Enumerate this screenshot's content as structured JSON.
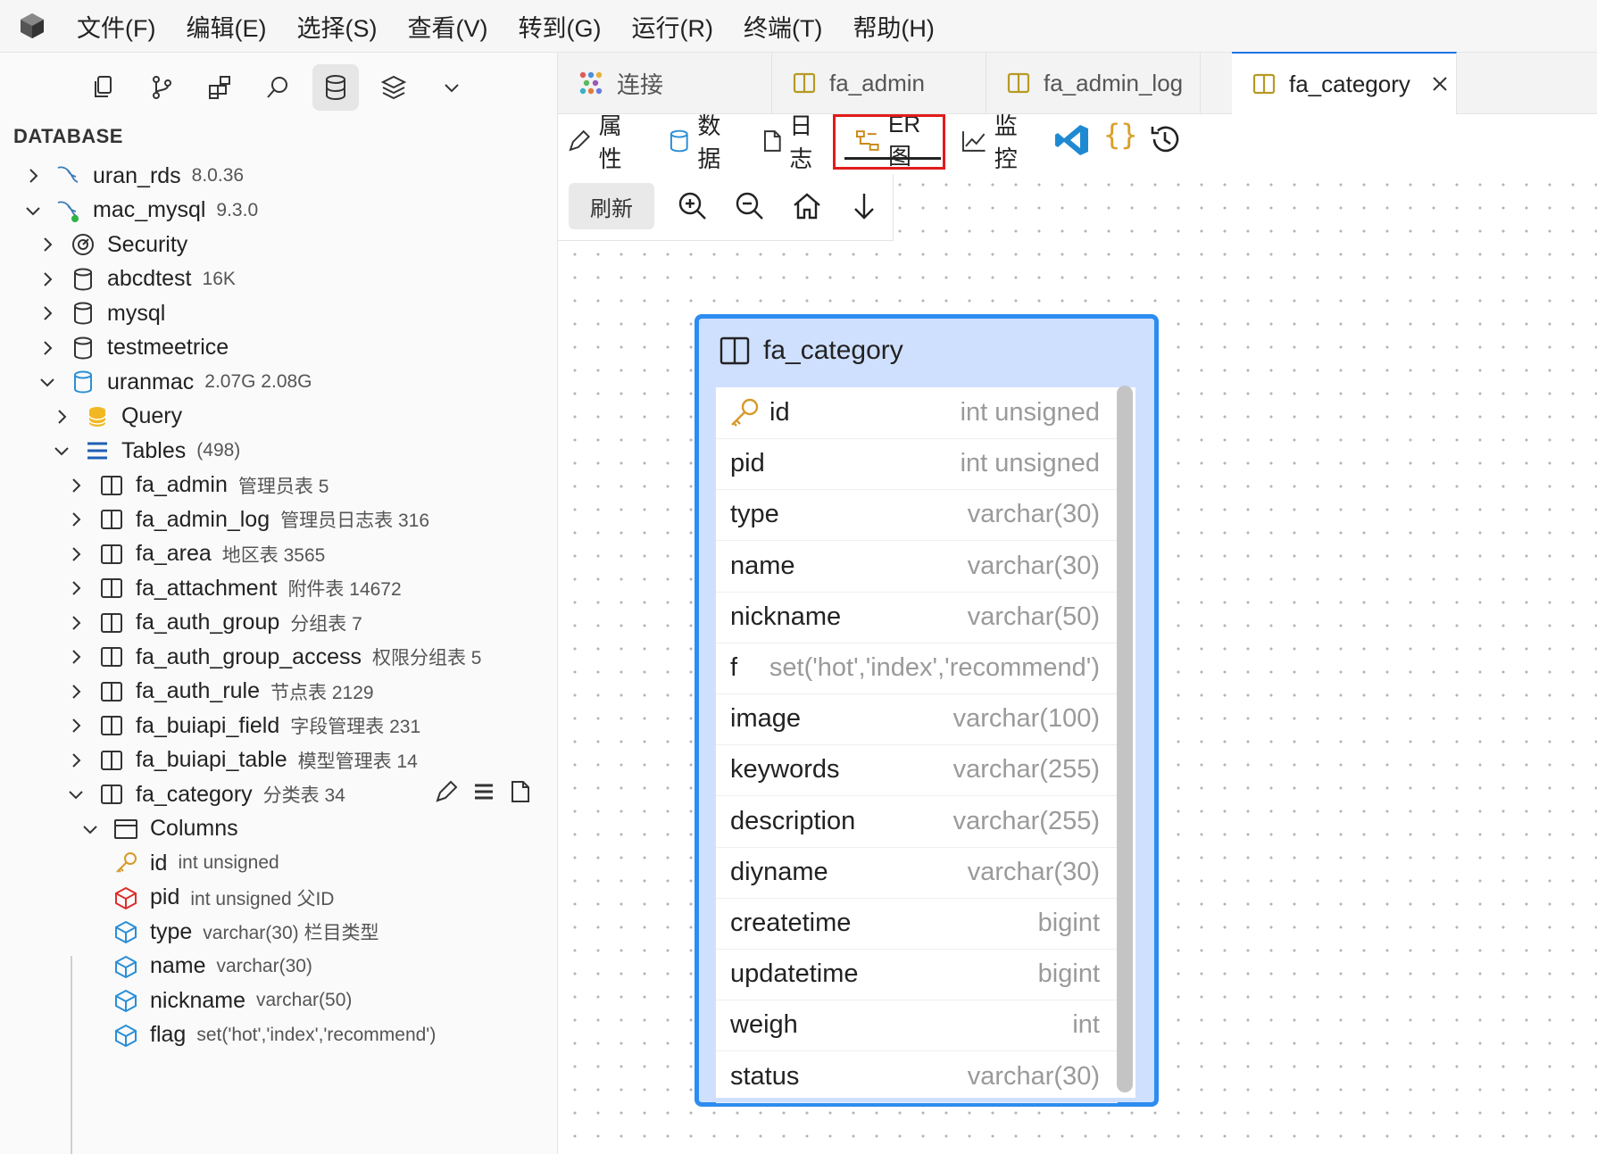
{
  "menu": [
    "文件(F)",
    "编辑(E)",
    "选择(S)",
    "查看(V)",
    "转到(G)",
    "运行(R)",
    "终端(T)",
    "帮助(H)"
  ],
  "sidebar": {
    "header": "DATABASE",
    "activity_icons": [
      "files-icon",
      "source-control-icon",
      "extensions-icon",
      "search-icon",
      "database-icon",
      "layers-icon",
      "chevron-down-icon"
    ],
    "tree": [
      {
        "label": "uran_rds",
        "meta": "8.0.36"
      },
      {
        "label": "mac_mysql",
        "meta": "9.3.0"
      },
      {
        "label": "Security",
        "meta": ""
      },
      {
        "label": "abcdtest",
        "meta": "16K"
      },
      {
        "label": "mysql",
        "meta": ""
      },
      {
        "label": "testmeetrice",
        "meta": ""
      },
      {
        "label": "uranmac",
        "meta": "2.07G 2.08G"
      },
      {
        "label": "Query",
        "meta": ""
      },
      {
        "label": "Tables",
        "meta": "(498)"
      },
      {
        "label": "fa_admin",
        "meta": "管理员表 5"
      },
      {
        "label": "fa_admin_log",
        "meta": "管理员日志表 316"
      },
      {
        "label": "fa_area",
        "meta": "地区表 3565"
      },
      {
        "label": "fa_attachment",
        "meta": "附件表 14672"
      },
      {
        "label": "fa_auth_group",
        "meta": "分组表 7"
      },
      {
        "label": "fa_auth_group_access",
        "meta": "权限分组表 5"
      },
      {
        "label": "fa_auth_rule",
        "meta": "节点表 2129"
      },
      {
        "label": "fa_buiapi_field",
        "meta": "字段管理表 231"
      },
      {
        "label": "fa_buiapi_table",
        "meta": "模型管理表 14"
      },
      {
        "label": "fa_category",
        "meta": "分类表 34"
      },
      {
        "label": "Columns",
        "meta": ""
      },
      {
        "label": "id",
        "meta": "int unsigned"
      },
      {
        "label": "pid",
        "meta": "int unsigned 父ID"
      },
      {
        "label": "type",
        "meta": "varchar(30) 栏目类型"
      },
      {
        "label": "name",
        "meta": "varchar(30)"
      },
      {
        "label": "nickname",
        "meta": "varchar(50)"
      },
      {
        "label": "flag",
        "meta": "set('hot','index','recommend')"
      }
    ]
  },
  "tabs": [
    {
      "label": "连接"
    },
    {
      "label": "fa_admin"
    },
    {
      "label": "fa_admin_log"
    },
    {
      "label": "fa_category"
    }
  ],
  "toolbar": {
    "properties": "属性",
    "data": "数据",
    "log": "日志",
    "er": "ER图",
    "monitor": "监控"
  },
  "canvas_tools": {
    "refresh": "刷新"
  },
  "entity": {
    "title": "fa_category",
    "fields": [
      {
        "name": "id",
        "type": "int unsigned"
      },
      {
        "name": "pid",
        "type": "int unsigned"
      },
      {
        "name": "type",
        "type": "varchar(30)"
      },
      {
        "name": "name",
        "type": "varchar(30)"
      },
      {
        "name": "nickname",
        "type": "varchar(50)"
      },
      {
        "name": "f",
        "type": "set('hot','index','recommend')"
      },
      {
        "name": "image",
        "type": "varchar(100)"
      },
      {
        "name": "keywords",
        "type": "varchar(255)"
      },
      {
        "name": "description",
        "type": "varchar(255)"
      },
      {
        "name": "diyname",
        "type": "varchar(30)"
      },
      {
        "name": "createtime",
        "type": "bigint"
      },
      {
        "name": "updatetime",
        "type": "bigint"
      },
      {
        "name": "weigh",
        "type": "int"
      },
      {
        "name": "status",
        "type": "varchar(30)"
      }
    ]
  },
  "colors": {
    "accent": "#2d8cf0",
    "entity_header": "#cfe0ff",
    "highlight": "#e21b1b",
    "key_icon": "#d69a2a",
    "fk_icon": "#d9302c",
    "column_icon": "#2a8fd6",
    "status_dot": "#2fb344"
  }
}
